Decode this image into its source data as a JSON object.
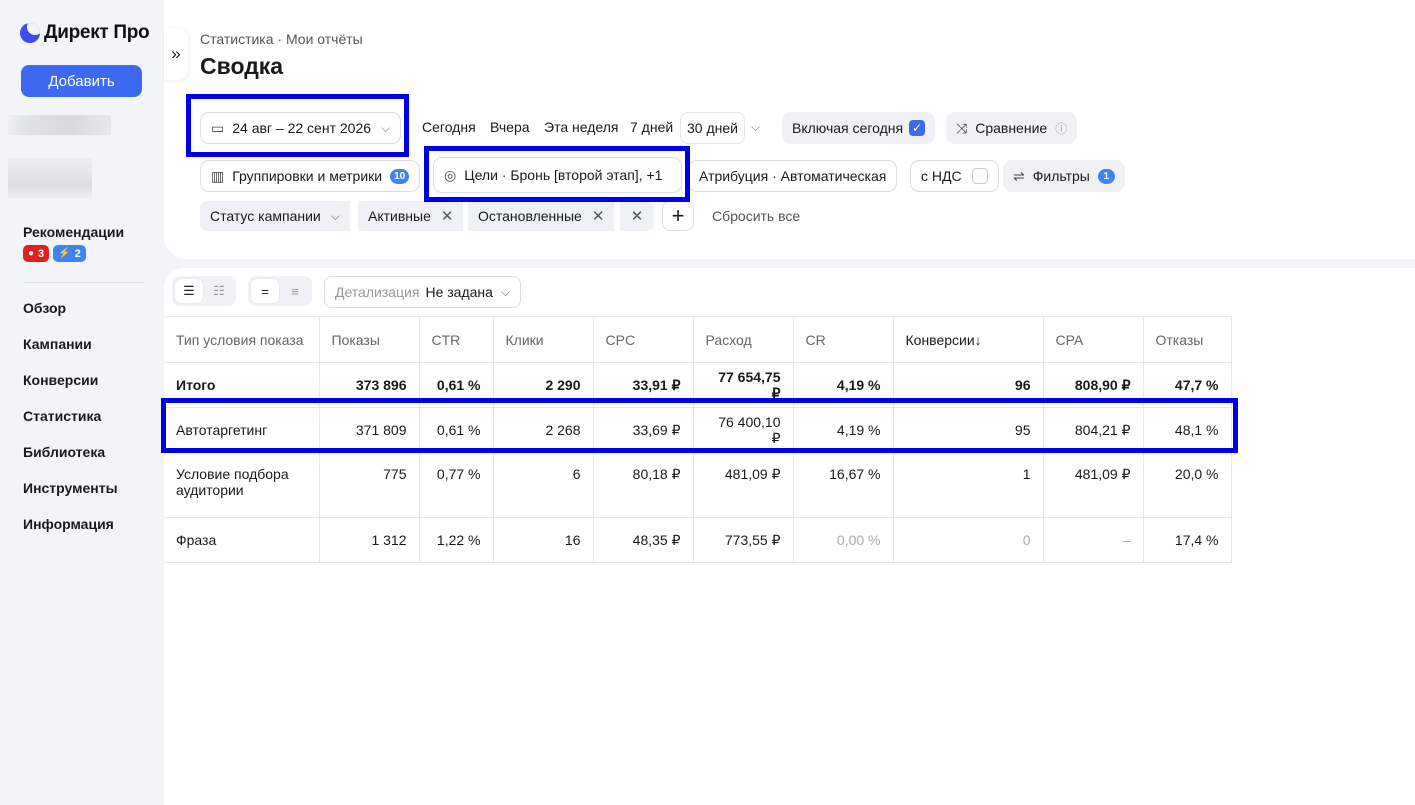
{
  "sidebar": {
    "logo": "Директ Про",
    "add_button": "Добавить",
    "recommendations": {
      "title": "Рекомендации",
      "alerts": "3",
      "tips": "2"
    },
    "nav": [
      "Обзор",
      "Кампании",
      "Конверсии",
      "Статистика",
      "Библиотека",
      "Инструменты",
      "Информация"
    ]
  },
  "header": {
    "breadcrumb": "Статистика · Мои отчёты",
    "title": "Сводка"
  },
  "toolbar": {
    "date_range": "24 авг – 22 сент 2026",
    "presets": [
      "Сегодня",
      "Вчера",
      "Эта неделя",
      "7 дней",
      "30 дней"
    ],
    "active_preset": "30 дней",
    "include_today": "Включая сегодня",
    "include_today_checked": true,
    "comparison": "Сравнение",
    "groupings": "Группировки и метрики",
    "groupings_count": "10",
    "goals": "Цели · Бронь [второй этап], +1",
    "attribution": "Атрибуция · Автоматическая",
    "vat": "с НДС",
    "vat_checked": false,
    "filters": "Фильтры",
    "filters_count": "1"
  },
  "filter_bar": {
    "field": "Статус кампании",
    "values": [
      "Активные",
      "Остановленные"
    ],
    "reset": "Сбросить все"
  },
  "table_toolbar": {
    "detail_label": "Детализация",
    "detail_value": "Не задана"
  },
  "table": {
    "columns": [
      "Тип условия показа",
      "Показы",
      "CTR",
      "Клики",
      "CPC",
      "Расход",
      "CR",
      "Конверсии↓",
      "CPA",
      "Отказы"
    ],
    "total": [
      "Итого",
      "373 896",
      "0,61 %",
      "2 290",
      "33,91 ₽",
      "77 654,75 ₽",
      "4,19 %",
      "96",
      "808,90 ₽",
      "47,7 %"
    ],
    "rows": [
      [
        "Автотаргетинг",
        "371 809",
        "0,61 %",
        "2 268",
        "33,69 ₽",
        "76 400,10 ₽",
        "4,19 %",
        "95",
        "804,21 ₽",
        "48,1 %"
      ],
      [
        "Условие подбора аудитории",
        "775",
        "0,77 %",
        "6",
        "80,18 ₽",
        "481,09 ₽",
        "16,67 %",
        "1",
        "481,09 ₽",
        "20,0 %"
      ],
      [
        "Фраза",
        "1 312",
        "1,22 %",
        "16",
        "48,35 ₽",
        "773,55 ₽",
        "0,00 %",
        "0",
        "–",
        "17,4 %"
      ]
    ]
  }
}
